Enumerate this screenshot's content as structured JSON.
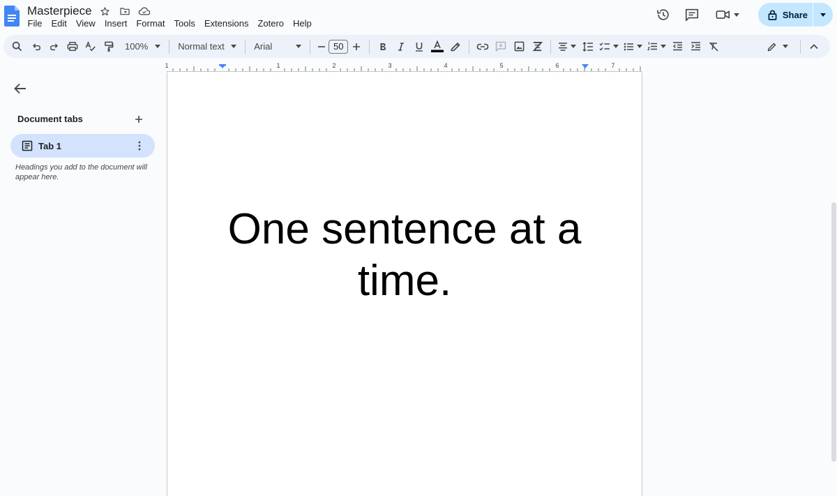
{
  "header": {
    "title": "Masterpiece",
    "menu": [
      "File",
      "Edit",
      "View",
      "Insert",
      "Format",
      "Tools",
      "Extensions",
      "Zotero",
      "Help"
    ],
    "share_label": "Share"
  },
  "toolbar": {
    "zoom": "100%",
    "style": "Normal text",
    "font": "Arial",
    "font_size": "50"
  },
  "ruler": {
    "labels": [
      "1",
      "1",
      "2",
      "3",
      "4",
      "5",
      "6",
      "7"
    ]
  },
  "sidebar": {
    "tabs_header": "Document tabs",
    "tabs": [
      {
        "label": "Tab 1"
      }
    ],
    "hint": "Headings you add to the document will appear here."
  },
  "document": {
    "body": "One sentence at a time."
  },
  "colors": {
    "accent": "#c2e7ff",
    "tab_selected": "#d3e3fd",
    "toolbar_bg": "#edf2fa",
    "docs_blue": "#4285f4"
  }
}
